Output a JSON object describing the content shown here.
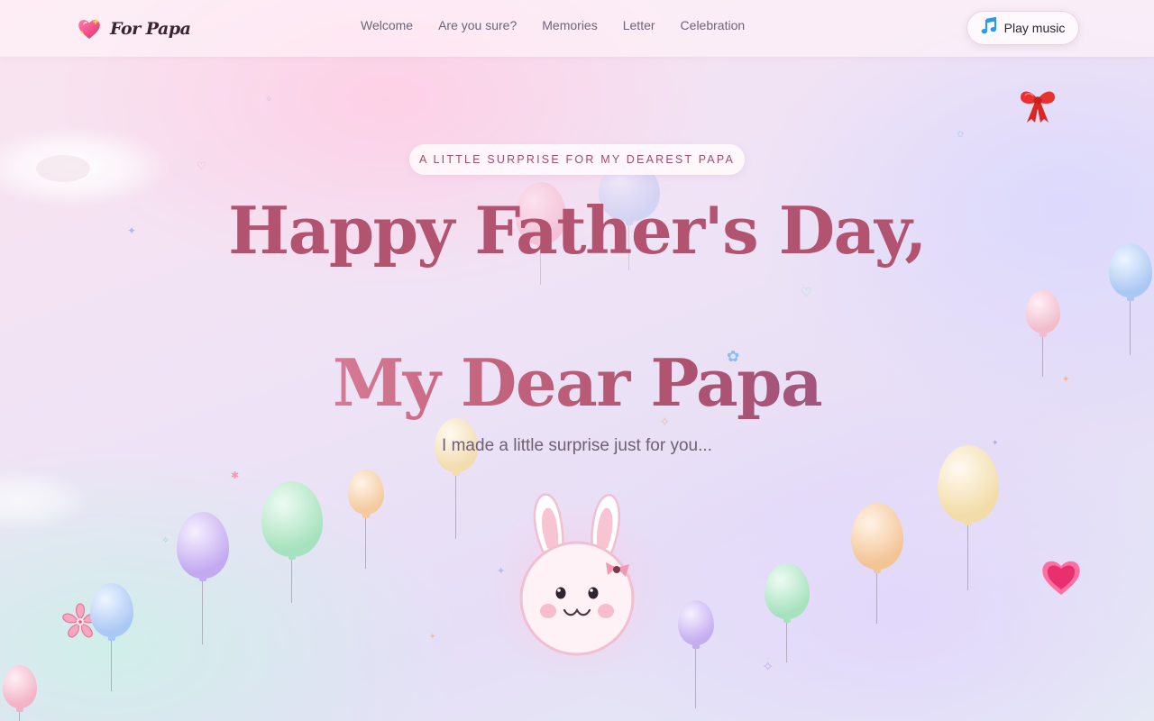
{
  "nav": {
    "brand": "For Papa",
    "links": [
      "Welcome",
      "Are you sure?",
      "Memories",
      "Letter",
      "Celebration"
    ],
    "music_button": "Play music"
  },
  "hero": {
    "eyebrow": "A LITTLE SURPRISE FOR MY DEAREST PAPA",
    "headline_line1": "Happy Father's Day,",
    "headline_line2": "My Dear Papa",
    "subtitle": "I made a little surprise just for you..."
  },
  "icons": {
    "brand": "sparkling-heart-icon",
    "music": "musical-note-icon",
    "ribbon": "ribbon-bow-icon",
    "heart": "heart-icon",
    "flower": "cherry-blossom-icon",
    "mascot": "bunny-icon"
  },
  "colors": {
    "accent": "#b2536f",
    "eyebrow": "#a34a70",
    "subtitle": "#6f6073",
    "music_note": "#2a9be6"
  }
}
